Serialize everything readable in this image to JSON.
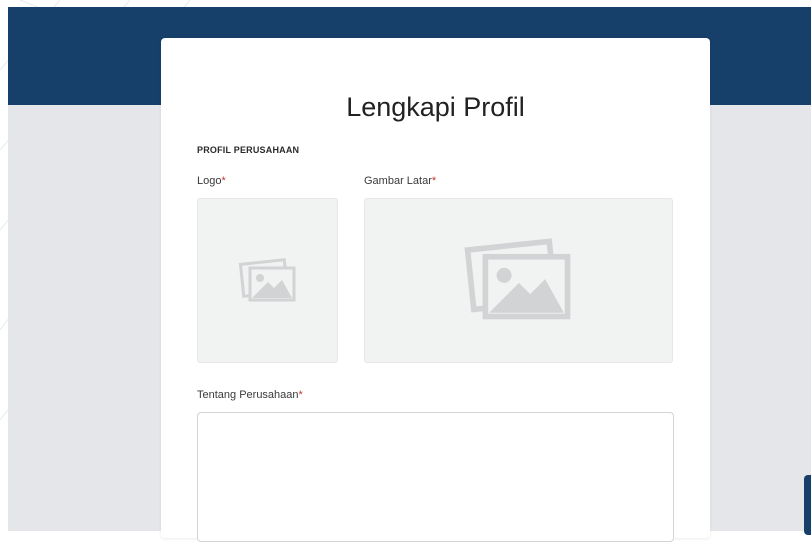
{
  "page": {
    "title": "Lengkapi Profil"
  },
  "section": {
    "heading": "PROFIL PERUSAHAAN"
  },
  "fields": {
    "logo": {
      "label": "Logo",
      "required_mark": "*"
    },
    "background": {
      "label": "Gambar Latar",
      "required_mark": "*"
    },
    "about": {
      "label": "Tentang Perusahaan",
      "required_mark": "*",
      "value": ""
    }
  },
  "icons": {
    "upload": "image-placeholder-icon"
  },
  "colors": {
    "banner": "#163f69",
    "page_background": "#e5e6e9",
    "required_mark": "#c0392b",
    "placeholder_box": "#f1f2f2"
  }
}
